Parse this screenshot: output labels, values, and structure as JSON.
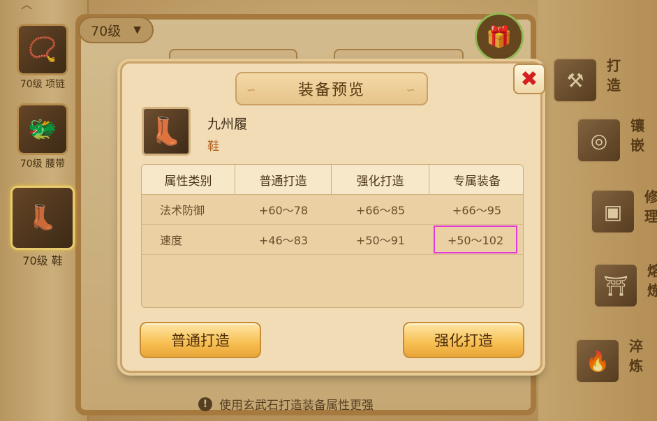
{
  "level_select": {
    "value": "70级"
  },
  "sidebar": {
    "items": [
      {
        "label": "70级 项链",
        "icon": "necklace-icon"
      },
      {
        "label": "70级 腰带",
        "icon": "belt-icon"
      },
      {
        "label": "70级 鞋",
        "icon": "boots-icon",
        "active": true
      }
    ]
  },
  "right_menu": {
    "items": [
      {
        "label": "打造",
        "icon": "forge-icon"
      },
      {
        "label": "镶嵌",
        "icon": "inlay-icon"
      },
      {
        "label": "修理",
        "icon": "repair-icon"
      },
      {
        "label": "熔炼",
        "icon": "smelt-icon"
      },
      {
        "label": "淬炼",
        "icon": "temper-icon"
      }
    ]
  },
  "tip": {
    "text": "使用玄武石打造装备属性更强"
  },
  "modal": {
    "title": "装备预览",
    "close_icon": "✖",
    "item": {
      "name": "九州履",
      "type": "鞋",
      "icon": "boots-icon"
    },
    "table": {
      "headers": [
        "属性类别",
        "普通打造",
        "强化打造",
        "专属装备"
      ],
      "rows": [
        [
          "法术防御",
          "+60～78",
          "+66～85",
          "+66～95"
        ],
        [
          "速度",
          "+46～83",
          "+50～91",
          "+50～102"
        ]
      ],
      "highlighted_cell": {
        "row": 1,
        "col": 3
      }
    },
    "buttons": {
      "normal": "普通打造",
      "enhanced": "强化打造"
    }
  },
  "colors": {
    "highlight_border": "#e23ad8",
    "button_fill": "#f7bf52",
    "close_x": "#d42020"
  }
}
